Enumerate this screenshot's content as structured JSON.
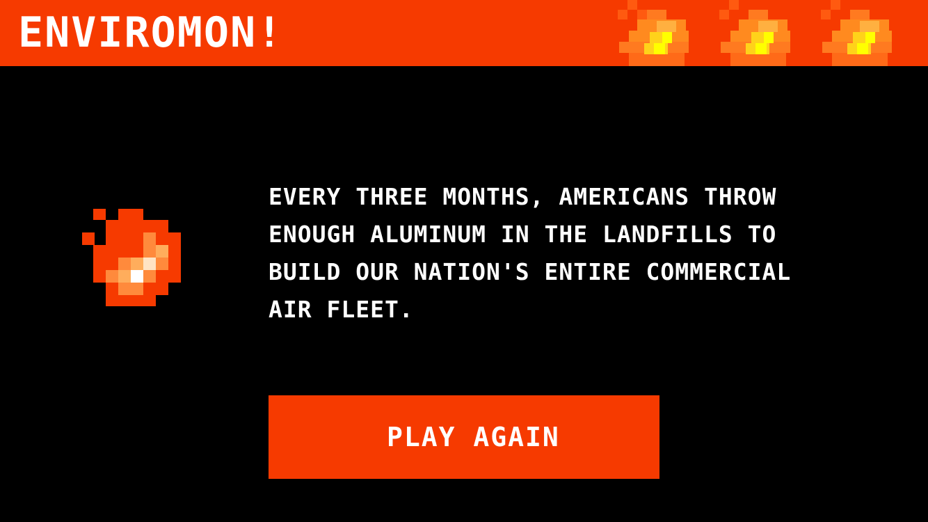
{
  "header": {
    "title": "ENVIROMON!",
    "background_color": "#f63a00",
    "decoration_icon": "pixel-fire-icon"
  },
  "fact": {
    "icon": "pixel-fire-icon",
    "text": "EVERY THREE MONTHS, AMERICANS THROW ENOUGH ALUMINUM IN THE LANDFILLS TO BUILD OUR NATION'S ENTIRE COMMERCIAL AIR FLEET."
  },
  "play_again": {
    "label": "PLAY AGAIN",
    "background_color": "#f63a00"
  },
  "colors": {
    "background": "#000000",
    "text": "#ffffff",
    "fire_red": "#f63a00",
    "fire_orange": "#ff8a1f",
    "fire_light": "#ffad5c",
    "fire_yellow": "#ffff00"
  }
}
